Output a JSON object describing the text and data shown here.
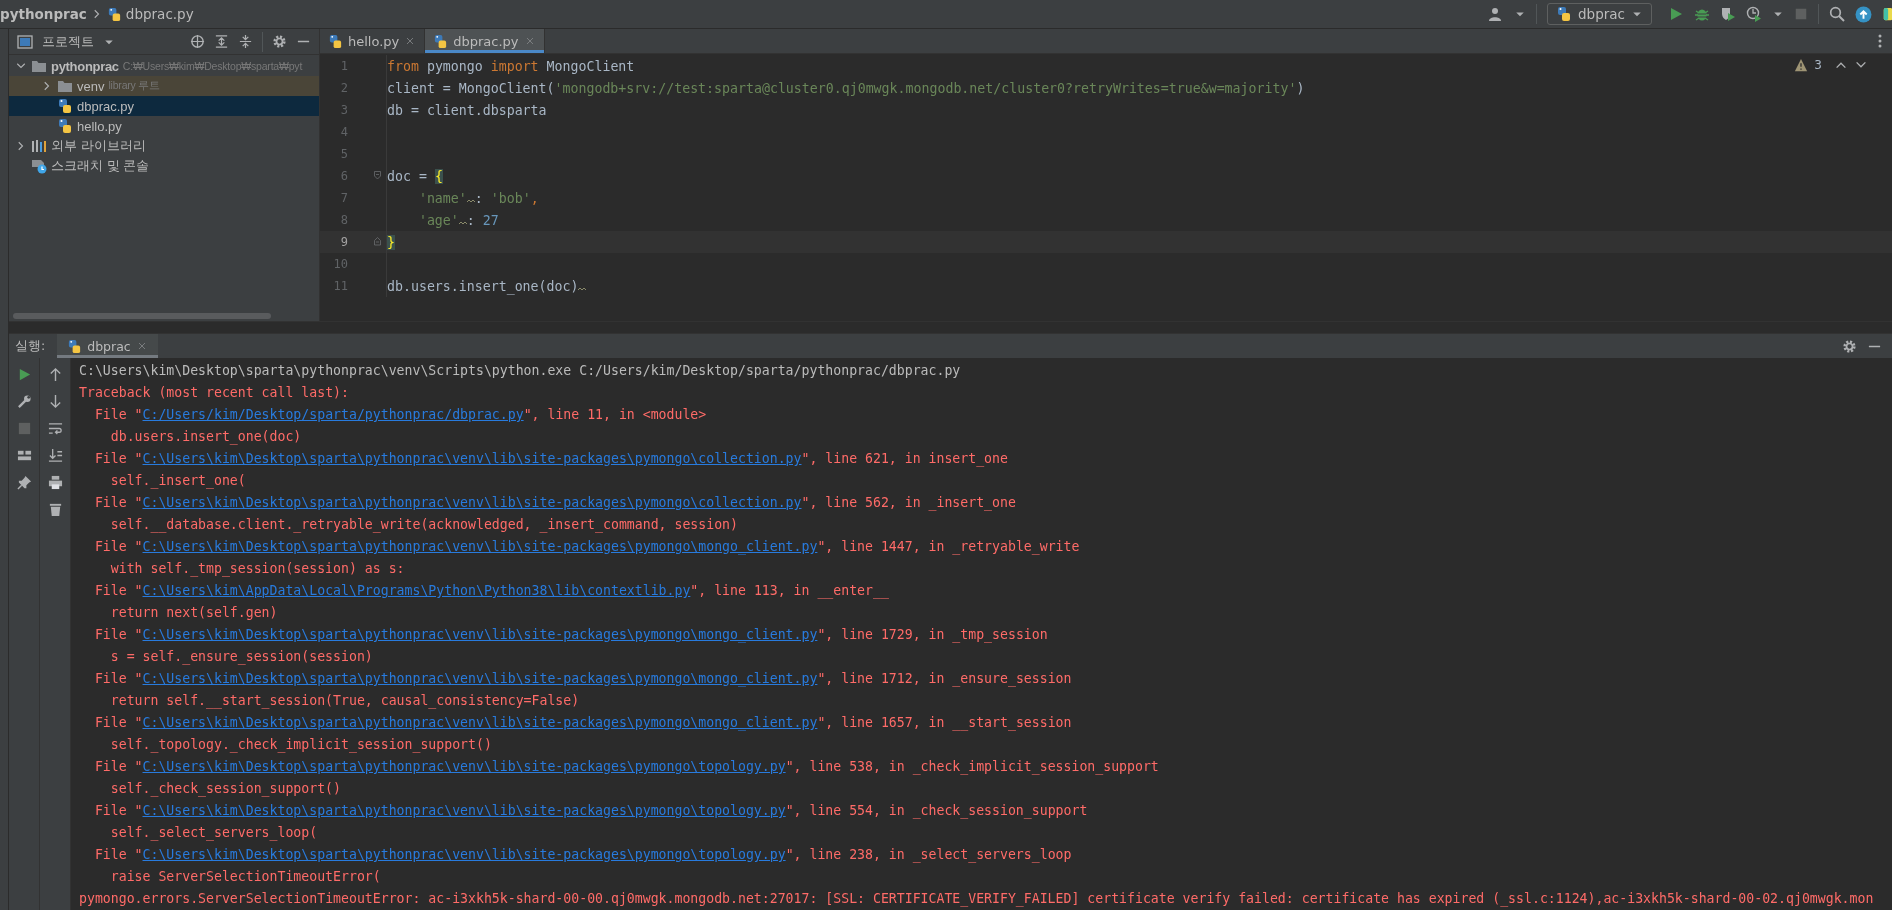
{
  "breadcrumb": [
    {
      "label": "pythonprac",
      "kind": "project"
    },
    {
      "label": "dbprac.py",
      "kind": "file"
    }
  ],
  "toolbar": {
    "run_config": "dbprac"
  },
  "project_panel": {
    "title": "프로젝트",
    "tree": [
      {
        "kind": "folder",
        "label": "pythonprac",
        "path": "C:₩Users₩kim₩Desktop₩sparta₩pyt",
        "expanded": true,
        "selected": false,
        "children": [
          {
            "kind": "excluded",
            "label": "venv",
            "note": "library 루트",
            "expanded": false,
            "selected": false
          },
          {
            "kind": "file",
            "label": "dbprac.py",
            "selected": true
          },
          {
            "kind": "file",
            "label": "hello.py",
            "selected": false
          }
        ]
      },
      {
        "kind": "library",
        "label": "외부 라이브러리",
        "expanded": false,
        "selected": false
      },
      {
        "kind": "scratch",
        "label": "스크래치 및 콘솔",
        "selected": false
      }
    ]
  },
  "editor": {
    "tabs": [
      {
        "label": "hello.py",
        "selected": false
      },
      {
        "label": "dbprac.py",
        "selected": true
      }
    ],
    "warnings": "3",
    "lines": [
      {
        "number": "1",
        "kind": "plain",
        "current": false,
        "tokens": [
          {
            "t": "from",
            "kind": "kw"
          },
          {
            "t": " pymongo ",
            "kind": "plain"
          },
          {
            "t": "import",
            "kind": "kw"
          },
          {
            "t": " MongoClient",
            "kind": "plain"
          }
        ]
      },
      {
        "number": "2",
        "kind": "plain",
        "current": false,
        "tokens": [
          {
            "t": "client = MongoClient(",
            "kind": "plain"
          },
          {
            "t": "'mongodb+srv://test:sparta@cluster0.qj0mwgk.mongodb.net/cluster0?retryWrites=true&w=majority'",
            "kind": "str"
          },
          {
            "t": ")",
            "kind": "plain"
          }
        ]
      },
      {
        "number": "3",
        "kind": "plain",
        "current": false,
        "tokens": [
          {
            "t": "db = client.dbsparta",
            "kind": "plain"
          }
        ]
      },
      {
        "number": "4",
        "kind": "plain",
        "current": false
      },
      {
        "number": "5",
        "kind": "plain",
        "current": false
      },
      {
        "number": "6",
        "kind": "fold_start",
        "current": false,
        "tokens": [
          {
            "t": "doc = ",
            "kind": "plain"
          },
          {
            "t": "{",
            "kind": "brace"
          }
        ]
      },
      {
        "number": "7",
        "kind": "plain",
        "current": false,
        "tokens": [
          {
            "t": "    'name'",
            "kind": "str"
          },
          {
            "kind": "squiggle"
          },
          {
            "t": ": ",
            "kind": "plain"
          },
          {
            "t": "'bob'",
            "kind": "str"
          },
          {
            "t": ",",
            "kind": "kw"
          }
        ]
      },
      {
        "number": "8",
        "kind": "plain",
        "current": false,
        "tokens": [
          {
            "t": "    'age'",
            "kind": "str"
          },
          {
            "kind": "squiggle"
          },
          {
            "t": ": ",
            "kind": "plain"
          },
          {
            "t": "27",
            "kind": "num"
          }
        ]
      },
      {
        "number": "9",
        "kind": "fold_end",
        "current": true,
        "tokens": [
          {
            "t": "}",
            "kind": "brace"
          }
        ]
      },
      {
        "number": "10",
        "kind": "plain",
        "current": false
      },
      {
        "number": "11",
        "kind": "plain",
        "current": false,
        "tokens": [
          {
            "t": "db.users.insert_one(doc)",
            "kind": "plain"
          },
          {
            "kind": "squiggle"
          }
        ]
      }
    ]
  },
  "run_panel": {
    "label": "실행:",
    "tabs": [
      {
        "label": "dbprac",
        "selected": true
      }
    ],
    "console": [
      {
        "kind": "plain",
        "text": "C:\\Users\\kim\\Desktop\\sparta\\pythonprac\\venv\\Scripts\\python.exe C:/Users/kim/Desktop/sparta/pythonprac/dbprac.py"
      },
      {
        "kind": "error",
        "text": "Traceback (most recent call last):"
      },
      {
        "kind": "frame",
        "before": "File \"",
        "link": "C:/Users/kim/Desktop/sparta/pythonprac/dbprac.py",
        "after": "\", line 11, in <module>"
      },
      {
        "kind": "code",
        "text": "db.users.insert_one(doc)"
      },
      {
        "kind": "frame",
        "before": "File \"",
        "link": "C:\\Users\\kim\\Desktop\\sparta\\pythonprac\\venv\\lib\\site-packages\\pymongo\\collection.py",
        "after": "\", line 621, in insert_one"
      },
      {
        "kind": "code",
        "text": "self._insert_one("
      },
      {
        "kind": "frame",
        "before": "File \"",
        "link": "C:\\Users\\kim\\Desktop\\sparta\\pythonprac\\venv\\lib\\site-packages\\pymongo\\collection.py",
        "after": "\", line 562, in _insert_one"
      },
      {
        "kind": "code",
        "text": "self.__database.client._retryable_write(acknowledged, _insert_command, session)"
      },
      {
        "kind": "frame",
        "before": "File \"",
        "link": "C:\\Users\\kim\\Desktop\\sparta\\pythonprac\\venv\\lib\\site-packages\\pymongo\\mongo_client.py",
        "after": "\", line 1447, in _retryable_write"
      },
      {
        "kind": "code",
        "text": "with self._tmp_session(session) as s:"
      },
      {
        "kind": "frame",
        "before": "File \"",
        "link": "C:\\Users\\kim\\AppData\\Local\\Programs\\Python\\Python38\\lib\\contextlib.py",
        "after": "\", line 113, in __enter__"
      },
      {
        "kind": "code",
        "text": "return next(self.gen)"
      },
      {
        "kind": "frame",
        "before": "File \"",
        "link": "C:\\Users\\kim\\Desktop\\sparta\\pythonprac\\venv\\lib\\site-packages\\pymongo\\mongo_client.py",
        "after": "\", line 1729, in _tmp_session"
      },
      {
        "kind": "code",
        "text": "s = self._ensure_session(session)"
      },
      {
        "kind": "frame",
        "before": "File \"",
        "link": "C:\\Users\\kim\\Desktop\\sparta\\pythonprac\\venv\\lib\\site-packages\\pymongo\\mongo_client.py",
        "after": "\", line 1712, in _ensure_session"
      },
      {
        "kind": "code",
        "text": "return self.__start_session(True, causal_consistency=False)"
      },
      {
        "kind": "frame",
        "before": "File \"",
        "link": "C:\\Users\\kim\\Desktop\\sparta\\pythonprac\\venv\\lib\\site-packages\\pymongo\\mongo_client.py",
        "after": "\", line 1657, in __start_session"
      },
      {
        "kind": "code",
        "text": "self._topology._check_implicit_session_support()"
      },
      {
        "kind": "frame",
        "before": "File \"",
        "link": "C:\\Users\\kim\\Desktop\\sparta\\pythonprac\\venv\\lib\\site-packages\\pymongo\\topology.py",
        "after": "\", line 538, in _check_implicit_session_support"
      },
      {
        "kind": "code",
        "text": "self._check_session_support()"
      },
      {
        "kind": "frame",
        "before": "File \"",
        "link": "C:\\Users\\kim\\Desktop\\sparta\\pythonprac\\venv\\lib\\site-packages\\pymongo\\topology.py",
        "after": "\", line 554, in _check_session_support"
      },
      {
        "kind": "code",
        "text": "self._select_servers_loop("
      },
      {
        "kind": "frame",
        "before": "File \"",
        "link": "C:\\Users\\kim\\Desktop\\sparta\\pythonprac\\venv\\lib\\site-packages\\pymongo\\topology.py",
        "after": "\", line 238, in _select_servers_loop"
      },
      {
        "kind": "code",
        "text": "raise ServerSelectionTimeoutError("
      },
      {
        "kind": "error",
        "text": "pymongo.errors.ServerSelectionTimeoutError: ac-i3xkh5k-shard-00-00.qj0mwgk.mongodb.net:27017: [SSL: CERTIFICATE_VERIFY_FAILED] certificate verify failed: certificate has expired (_ssl.c:1124),ac-i3xkh5k-shard-00-02.qj0mwgk.mon"
      }
    ]
  }
}
